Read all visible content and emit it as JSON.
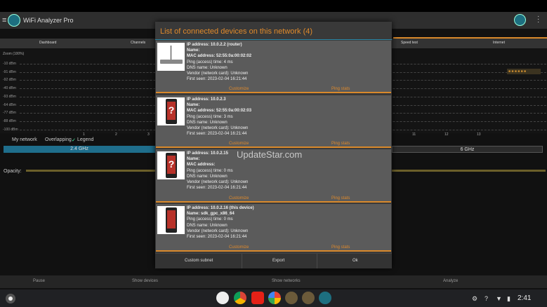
{
  "app": {
    "title": "WiFi Analyzer Pro"
  },
  "tabs": [
    {
      "label": "Dashboard"
    },
    {
      "label": "Channels"
    },
    {
      "label": "Speed test"
    },
    {
      "label": "Internet"
    }
  ],
  "chart": {
    "zoom": "Zoom (100%)",
    "y_ticks": [
      "-10 dBm",
      "-91 dBm",
      "-92 dBm",
      "-40 dBm",
      "-93 dBm",
      "-64 dBm",
      "-77 dBm",
      "-88 dBm",
      "-100 dBm"
    ],
    "x_ticks": [
      "1",
      "2",
      "3",
      "11",
      "12",
      "13"
    ],
    "legend_badge": "■ ■ ■ ■ ■ ■"
  },
  "filters": {
    "my_network": "My network",
    "overlapping": "Overlapping",
    "legend": "Legend",
    "band_24": "2.4 GHz",
    "band_6": "6 GHz",
    "opacity": "Opacity:"
  },
  "bottom_actions": [
    {
      "label": "Pause"
    },
    {
      "label": "Show devices"
    },
    {
      "label": "Show networks"
    },
    {
      "label": "Analyze"
    }
  ],
  "dialog": {
    "title": "List of connected devices on this network (4)",
    "devices": [
      {
        "ip": "IP address: 10.0.2.2 (router)",
        "name": "Name:",
        "mac": "MAC address: 52:55:0a:00:02:02",
        "ping": "Ping (access) time: 4 ms",
        "dns": "DNS name: Unknown",
        "vendor": "Vendor (network card): Unknown",
        "first_seen": "First seen: 2023-02-04 16:21:44",
        "customize": "Customize",
        "ping_stats": "Ping stats"
      },
      {
        "ip": "IP address: 10.0.2.3",
        "name": "Name:",
        "mac": "MAC address: 52:55:0a:00:02:03",
        "ping": "Ping (access) time: 3 ms",
        "dns": "DNS name: Unknown",
        "vendor": "Vendor (network card): Unknown",
        "first_seen": "First seen: 2023-02-04 16:21:44",
        "customize": "Customize",
        "ping_stats": "Ping stats"
      },
      {
        "ip": "IP address: 10.0.2.15",
        "name": "Name:",
        "mac": "MAC address:",
        "ping": "Ping (access) time: 0 ms",
        "dns": "DNS name: Unknown",
        "vendor": "Vendor (network card): Unknown",
        "first_seen": "First seen: 2023-02-04 16:21:44",
        "customize": "Customize",
        "ping_stats": "Ping stats"
      },
      {
        "ip": "IP address: 10.0.2.16 (this device)",
        "name": "Name: sdk_gpc_x86_64",
        "mac": "Ping (access) time: 0 ms",
        "ping": "DNS name: Unknown",
        "dns": "Vendor (network card): Unknown",
        "vendor": "First seen: 2023-02-04 16:21:44",
        "first_seen": "",
        "customize": "Customize",
        "ping_stats": "Ping stats"
      }
    ],
    "buttons": {
      "custom_subnet": "Custom subnet",
      "export": "Export",
      "ok": "Ok"
    }
  },
  "watermark": "UpdateStar.com",
  "shelf": {
    "clock": "2:41"
  },
  "colors": {
    "accent": "#e08a2b",
    "dialog_bg": "#393939",
    "card_bg": "#5b5b5b",
    "band_selected": "#1f6e8c"
  }
}
